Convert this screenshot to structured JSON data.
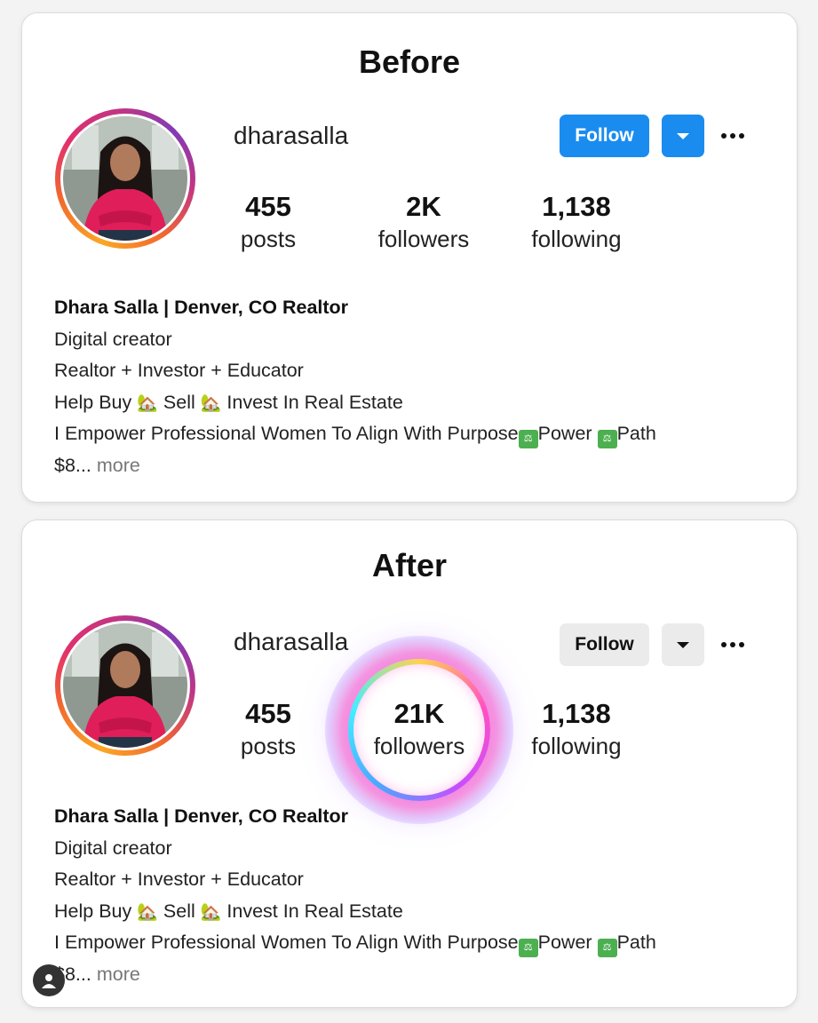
{
  "before": {
    "heading": "Before",
    "username": "dharasalla",
    "follow_label": "Follow",
    "posts_count": "455",
    "posts_label": "posts",
    "followers_count": "2K",
    "followers_label": "followers",
    "following_count": "1,138",
    "following_label": "following",
    "bio": {
      "name": "Dhara Salla | Denver, CO Realtor",
      "category": "Digital creator",
      "line1": "Realtor + Investor + Educator",
      "help_buy": "Help Buy",
      "sell": "Sell",
      "invest": "Invest In Real Estate",
      "empower": "I Empower Professional Women To Align With Purpose",
      "power": "Power",
      "path": "Path",
      "truncated": "$8...",
      "more": "more"
    }
  },
  "after": {
    "heading": "After",
    "username": "dharasalla",
    "follow_label": "Follow",
    "posts_count": "455",
    "posts_label": "posts",
    "followers_count": "21K",
    "followers_label": "followers",
    "following_count": "1,138",
    "following_label": "following",
    "bio": {
      "name": "Dhara Salla | Denver, CO Realtor",
      "category": "Digital creator",
      "line1": "Realtor + Investor + Educator",
      "help_buy": "Help Buy",
      "sell": "Sell",
      "invest": "Invest In Real Estate",
      "empower": "I Empower Professional Women To Align With Purpose",
      "power": "Power",
      "path": "Path",
      "truncated": "$8...",
      "more": "more"
    }
  },
  "icons": {
    "house": "house-emoji-icon",
    "path_emoji": "purpose-emoji-icon",
    "chevron": "chevron-down-icon",
    "more": "more-horizontal-icon",
    "profile_fab": "person-icon"
  },
  "colors": {
    "follow_blue": "#1a8cf0",
    "follow_gray": "#ebebeb",
    "ring_gradient": [
      "#f9a825",
      "#f26a2e",
      "#e1306c",
      "#c13584",
      "#833ab4"
    ],
    "glow_gradient": [
      "#ffd34d",
      "#ff4fc4",
      "#c94dff",
      "#4da6ff",
      "#3ff0ff"
    ]
  }
}
